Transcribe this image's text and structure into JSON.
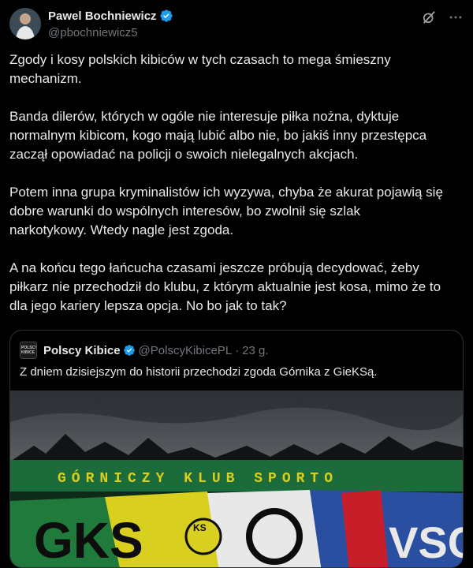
{
  "author": {
    "display_name": "Pawel Bochniewicz",
    "handle": "@pbochniewicz5"
  },
  "icons": {
    "verified": "verified-badge-icon",
    "grok": "grok-icon",
    "more": "more-dots-icon"
  },
  "tweet": {
    "text": "Zgody i kosy polskich kibiców w tych czasach to mega śmieszny\nmechanizm.\n\nBanda dilerów, których w ogóle nie interesuje piłka nożna, dyktuje\nnormalnym kibicom, kogo mają lubić albo nie, bo jakiś inny przestępca\nzaczął opowiadać na policji o swoich nielegalnych akcjach.\n\nPotem inna grupa kryminalistów ich wyzywa, chyba że akurat pojawią się\ndobre warunki do wspólnych interesów, bo zwolnił się szlak\nnarkotykowy. Wtedy nagle jest zgoda.\n\nA na końcu tego łańcucha czasami jeszcze próbują decydować, żeby\npiłkarz nie przechodził do klubu, z którym aktualnie jest kosa, mimo że to\ndla jego kariery lepsza opcja. No bo jak to tak?"
  },
  "quote": {
    "avatar_text": "POLSCY KIBICE",
    "display_name": "Polscy Kibice",
    "handle": "@PolscyKibicePL",
    "separator": "·",
    "time": "23 g.",
    "text": "Z dniem dzisiejszym do historii przechodzi zgoda Górnika z GieKSą.",
    "banner_text": "GÓRNICZY KLUB SPORTO",
    "flag_text": "GKS",
    "flag_text_2": "KS",
    "flag_text_3": "VSC"
  },
  "colors": {
    "background": "#000000",
    "text": "#e7e9ea",
    "muted": "#71767b",
    "verified": "#1d9bf0",
    "border": "#2f3336",
    "banner_green": "#1c6b3a",
    "banner_yellow": "#d9cf1e"
  }
}
